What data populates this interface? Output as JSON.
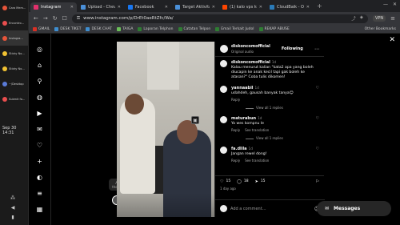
{
  "os_panel": {
    "items": [
      {
        "label": "Cara Mem…",
        "color": "#e8553a"
      },
      {
        "label": "Encontro…",
        "color": "#e94e4e"
      },
      {
        "label": "Instagra…",
        "color": "#e8553a"
      },
      {
        "label": "Sticky No…",
        "color": "#f1c232"
      },
      {
        "label": "Sticky No…",
        "color": "#f1c232"
      },
      {
        "label": "~/Desktop",
        "color": "#5a7bd8"
      },
      {
        "label": "Submit fo…",
        "color": "#e94e4e"
      }
    ],
    "clock": "Sep 30  14:31"
  },
  "browser": {
    "tabs": [
      {
        "label": "Instagram",
        "color": "#e1306c"
      },
      {
        "label": "Upload - Chevero",
        "color": "#4a90d9"
      },
      {
        "label": "Facebook",
        "color": "#1877f2"
      },
      {
        "label": "Target Aktivitas",
        "color": "#4a90d9"
      },
      {
        "label": "(1) kalo vps kebo",
        "color": "#ff4500"
      },
      {
        "label": "CloudBaik - Open",
        "color": "#2a7ab8"
      }
    ],
    "url": "www.instagram.com/p/DrEt0aeRtZfc/Wa/",
    "vpn_label": "VPN",
    "bookmarks": [
      {
        "label": "GMAIL",
        "color": "#d93025"
      },
      {
        "label": "DESK TIKET",
        "color": "#3e8ed0"
      },
      {
        "label": "DESK CHAT",
        "color": "#3e8ed0"
      },
      {
        "label": "TAIGA",
        "color": "#6bbf59"
      },
      {
        "label": "Laporan Telphon",
        "color": "#2e7d32"
      },
      {
        "label": "Catatan Telpon",
        "color": "#2e7d32"
      },
      {
        "label": "Email Terkait Judol",
        "color": "#2e7d32"
      },
      {
        "label": "REKAP ABUSE",
        "color": "#2e7d32"
      }
    ],
    "other_bookmarks": "Other Bookmarks"
  },
  "instagram": {
    "nav_icons": [
      "instagram-icon",
      "home-icon",
      "search-icon",
      "explore-icon",
      "reels-icon",
      "messenger-icon",
      "heart-icon",
      "create-icon",
      "profile-icon",
      "menu-icon",
      "grid-icon"
    ],
    "post": {
      "username": "diskoncomofficial",
      "subtitle": "Original audio",
      "follow_label": "Following"
    },
    "comments": [
      {
        "user": "diskoncomofficial",
        "time": "1d",
        "text": "Kalau menurut kalian \"kata2 apa yang boleh diucapin ke anak kecil tapi gak boleh ke atasan?\" Coba tulis dikomen!",
        "likes": "",
        "has_replies": false
      },
      {
        "user": "yannaabil",
        "time": "1d",
        "text": "udahdeh, gausah banyak tanya😊",
        "reply": "Reply",
        "view_replies": "View all 1 replies"
      },
      {
        "user": "maturabun",
        "time": "1d",
        "text": "Yo wes kompnu le",
        "reply": "Reply",
        "translation": "See translation",
        "view_replies": "View all 1 replies"
      },
      {
        "user": "fa.dlila",
        "time": "1d",
        "text": "Jangan rewel dong!",
        "reply": "Reply",
        "translation": "See translation"
      }
    ],
    "stats": {
      "likes": "15",
      "comments": "18",
      "shares": "15"
    },
    "ago": "1 day ago",
    "add_comment_placeholder": "Add a comment…",
    "thought_text": "Add a thought…",
    "story_label": "diskon…",
    "messages_label": "Messages"
  }
}
